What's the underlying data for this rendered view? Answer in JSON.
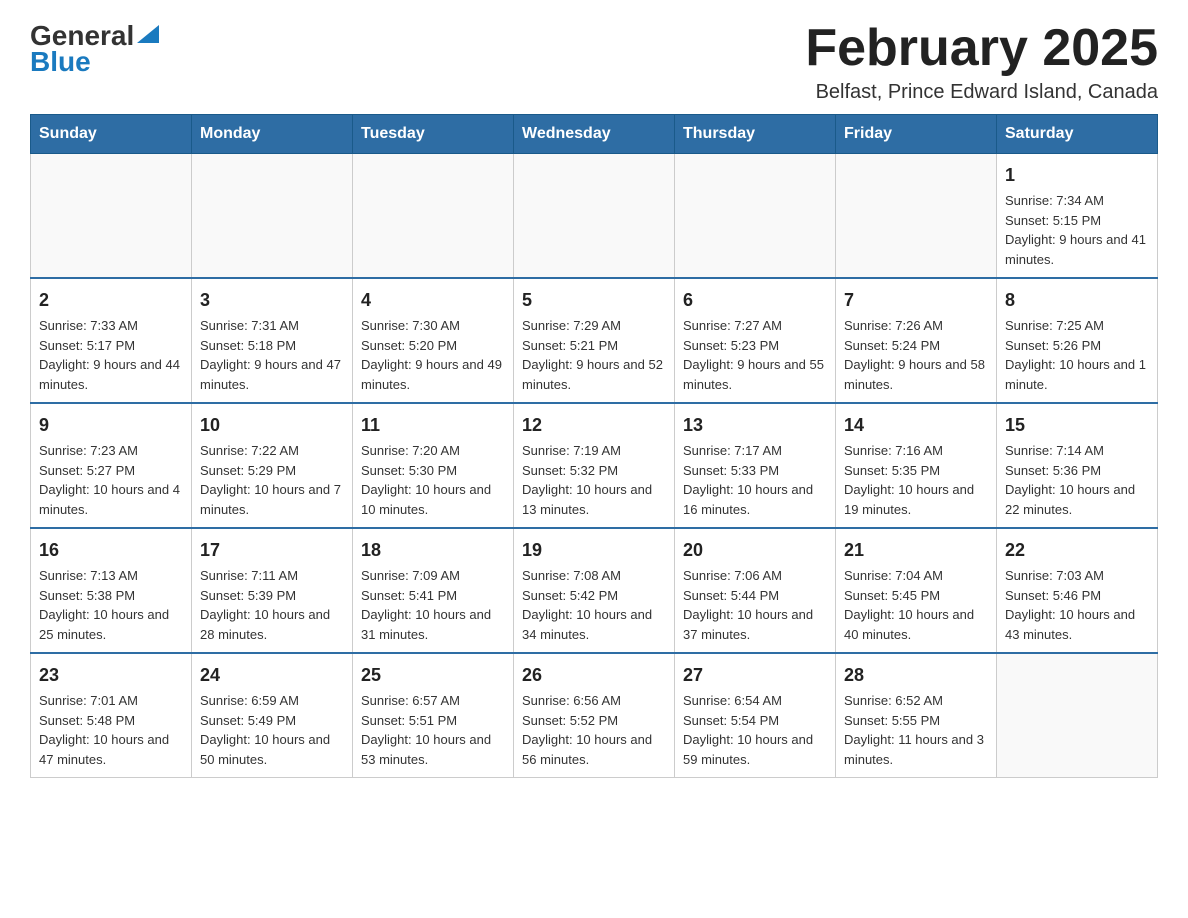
{
  "header": {
    "logo_general": "General",
    "logo_blue": "Blue",
    "title": "February 2025",
    "subtitle": "Belfast, Prince Edward Island, Canada"
  },
  "weekdays": [
    "Sunday",
    "Monday",
    "Tuesday",
    "Wednesday",
    "Thursday",
    "Friday",
    "Saturday"
  ],
  "weeks": [
    [
      {
        "day": "",
        "info": ""
      },
      {
        "day": "",
        "info": ""
      },
      {
        "day": "",
        "info": ""
      },
      {
        "day": "",
        "info": ""
      },
      {
        "day": "",
        "info": ""
      },
      {
        "day": "",
        "info": ""
      },
      {
        "day": "1",
        "info": "Sunrise: 7:34 AM\nSunset: 5:15 PM\nDaylight: 9 hours and 41 minutes."
      }
    ],
    [
      {
        "day": "2",
        "info": "Sunrise: 7:33 AM\nSunset: 5:17 PM\nDaylight: 9 hours and 44 minutes."
      },
      {
        "day": "3",
        "info": "Sunrise: 7:31 AM\nSunset: 5:18 PM\nDaylight: 9 hours and 47 minutes."
      },
      {
        "day": "4",
        "info": "Sunrise: 7:30 AM\nSunset: 5:20 PM\nDaylight: 9 hours and 49 minutes."
      },
      {
        "day": "5",
        "info": "Sunrise: 7:29 AM\nSunset: 5:21 PM\nDaylight: 9 hours and 52 minutes."
      },
      {
        "day": "6",
        "info": "Sunrise: 7:27 AM\nSunset: 5:23 PM\nDaylight: 9 hours and 55 minutes."
      },
      {
        "day": "7",
        "info": "Sunrise: 7:26 AM\nSunset: 5:24 PM\nDaylight: 9 hours and 58 minutes."
      },
      {
        "day": "8",
        "info": "Sunrise: 7:25 AM\nSunset: 5:26 PM\nDaylight: 10 hours and 1 minute."
      }
    ],
    [
      {
        "day": "9",
        "info": "Sunrise: 7:23 AM\nSunset: 5:27 PM\nDaylight: 10 hours and 4 minutes."
      },
      {
        "day": "10",
        "info": "Sunrise: 7:22 AM\nSunset: 5:29 PM\nDaylight: 10 hours and 7 minutes."
      },
      {
        "day": "11",
        "info": "Sunrise: 7:20 AM\nSunset: 5:30 PM\nDaylight: 10 hours and 10 minutes."
      },
      {
        "day": "12",
        "info": "Sunrise: 7:19 AM\nSunset: 5:32 PM\nDaylight: 10 hours and 13 minutes."
      },
      {
        "day": "13",
        "info": "Sunrise: 7:17 AM\nSunset: 5:33 PM\nDaylight: 10 hours and 16 minutes."
      },
      {
        "day": "14",
        "info": "Sunrise: 7:16 AM\nSunset: 5:35 PM\nDaylight: 10 hours and 19 minutes."
      },
      {
        "day": "15",
        "info": "Sunrise: 7:14 AM\nSunset: 5:36 PM\nDaylight: 10 hours and 22 minutes."
      }
    ],
    [
      {
        "day": "16",
        "info": "Sunrise: 7:13 AM\nSunset: 5:38 PM\nDaylight: 10 hours and 25 minutes."
      },
      {
        "day": "17",
        "info": "Sunrise: 7:11 AM\nSunset: 5:39 PM\nDaylight: 10 hours and 28 minutes."
      },
      {
        "day": "18",
        "info": "Sunrise: 7:09 AM\nSunset: 5:41 PM\nDaylight: 10 hours and 31 minutes."
      },
      {
        "day": "19",
        "info": "Sunrise: 7:08 AM\nSunset: 5:42 PM\nDaylight: 10 hours and 34 minutes."
      },
      {
        "day": "20",
        "info": "Sunrise: 7:06 AM\nSunset: 5:44 PM\nDaylight: 10 hours and 37 minutes."
      },
      {
        "day": "21",
        "info": "Sunrise: 7:04 AM\nSunset: 5:45 PM\nDaylight: 10 hours and 40 minutes."
      },
      {
        "day": "22",
        "info": "Sunrise: 7:03 AM\nSunset: 5:46 PM\nDaylight: 10 hours and 43 minutes."
      }
    ],
    [
      {
        "day": "23",
        "info": "Sunrise: 7:01 AM\nSunset: 5:48 PM\nDaylight: 10 hours and 47 minutes."
      },
      {
        "day": "24",
        "info": "Sunrise: 6:59 AM\nSunset: 5:49 PM\nDaylight: 10 hours and 50 minutes."
      },
      {
        "day": "25",
        "info": "Sunrise: 6:57 AM\nSunset: 5:51 PM\nDaylight: 10 hours and 53 minutes."
      },
      {
        "day": "26",
        "info": "Sunrise: 6:56 AM\nSunset: 5:52 PM\nDaylight: 10 hours and 56 minutes."
      },
      {
        "day": "27",
        "info": "Sunrise: 6:54 AM\nSunset: 5:54 PM\nDaylight: 10 hours and 59 minutes."
      },
      {
        "day": "28",
        "info": "Sunrise: 6:52 AM\nSunset: 5:55 PM\nDaylight: 11 hours and 3 minutes."
      },
      {
        "day": "",
        "info": ""
      }
    ]
  ]
}
